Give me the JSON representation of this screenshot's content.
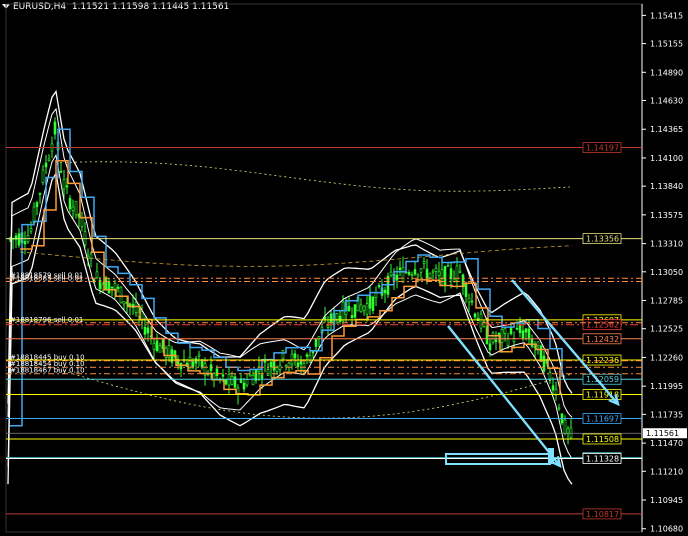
{
  "header": {
    "symbol": "EURUSD,H4",
    "open": "1.11521",
    "high": "1.11598",
    "low": "1.11445",
    "close": "1.11561"
  },
  "axis": {
    "price_min": 1.1065,
    "price_max": 1.1552,
    "ticks": [
      "1.15415",
      "1.15155",
      "1.14890",
      "1.14630",
      "1.14365",
      "1.14100",
      "1.13840",
      "1.13575",
      "1.13310",
      "1.13050",
      "1.12785",
      "1.12525",
      "1.12260",
      "1.11995",
      "1.11735",
      "1.11470",
      "1.11210",
      "1.10945",
      "1.10680"
    ],
    "current_price": "1.11561"
  },
  "levels": [
    {
      "price": 1.14197,
      "label": "1.14197",
      "color": "#c0392b",
      "style": "solid"
    },
    {
      "price": 1.13356,
      "label": "1.13356",
      "color": "#e6e07a",
      "style": "solid"
    },
    {
      "price": 1.12607,
      "label": "1.12607",
      "color": "#ffff00",
      "style": "solid"
    },
    {
      "price": 1.12562,
      "label": "1.12562",
      "color": "#ff3b3b",
      "style": "dash"
    },
    {
      "price": 1.12432,
      "label": "1.12432",
      "color": "#ff7f50",
      "style": "solid"
    },
    {
      "price": 1.12236,
      "label": "1.12236",
      "color": "#ffff00",
      "style": "solid"
    },
    {
      "price": 1.12059,
      "label": "1.12059",
      "color": "#4fd0e0",
      "style": "solid"
    },
    {
      "price": 1.11918,
      "label": "1.11918",
      "color": "#ffff00",
      "style": "solid"
    },
    {
      "price": 1.11697,
      "label": "1.11697",
      "color": "#3fa9f5",
      "style": "solid"
    },
    {
      "price": 1.11508,
      "label": "1.11508",
      "color": "#ffff00",
      "style": "solid"
    },
    {
      "price": 1.11335,
      "label": "1.11335",
      "color": "#4fd0e0",
      "style": "solid"
    },
    {
      "price": 1.11328,
      "label": "1.11328",
      "color": "#ffffff",
      "style": "solid"
    },
    {
      "price": 1.10817,
      "label": "1.10817",
      "color": "#c0392b",
      "style": "solid"
    }
  ],
  "orders": [
    {
      "price": 1.1299,
      "text": "#18818579 sell 0.01"
    },
    {
      "price": 1.1296,
      "text": "#18818583 sell 0.01"
    },
    {
      "price": 1.1258,
      "text": "#18818796 sell 0.01"
    },
    {
      "price": 1.1223,
      "text": "#18818445 buy 0.10"
    },
    {
      "price": 1.1217,
      "text": "#18818454 buy 0.10"
    },
    {
      "price": 1.1211,
      "text": "#18818467 buy 0.10"
    }
  ],
  "colors": {
    "background": "#000000",
    "axis_text": "#ffffff",
    "candle": "#32ff32",
    "band": "#ffffff",
    "ma_blue": "#3fa9f5",
    "ma_orange": "#ff9933",
    "ma_yellow": "#ffff66",
    "arrow": "#7fdfff"
  }
}
